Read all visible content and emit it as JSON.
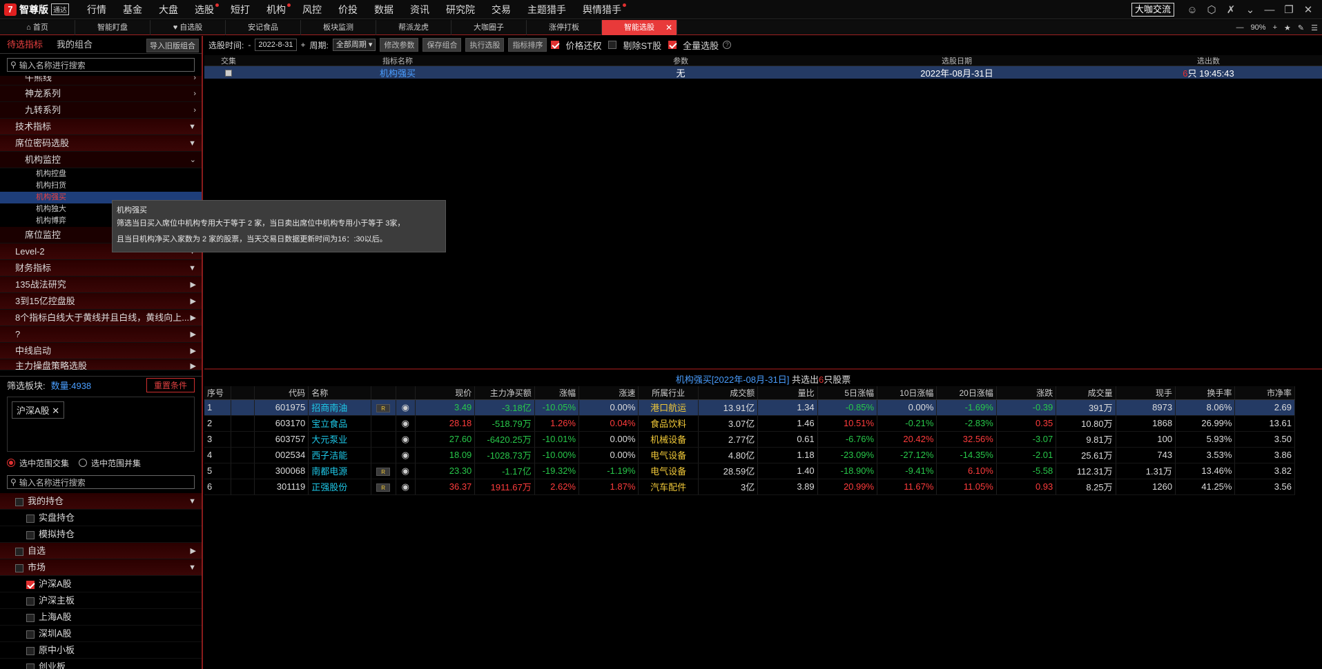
{
  "brand": {
    "name": "智尊版",
    "badge": "通达"
  },
  "top_menu": [
    {
      "label": "行情",
      "dot": false
    },
    {
      "label": "基金",
      "dot": false
    },
    {
      "label": "大盘",
      "dot": false
    },
    {
      "label": "选股",
      "dot": true
    },
    {
      "label": "短打",
      "dot": false
    },
    {
      "label": "机构",
      "dot": true
    },
    {
      "label": "风控",
      "dot": false
    },
    {
      "label": "价投",
      "dot": false
    },
    {
      "label": "数据",
      "dot": false
    },
    {
      "label": "资讯",
      "dot": false
    },
    {
      "label": "研究院",
      "dot": false
    },
    {
      "label": "交易",
      "dot": false
    },
    {
      "label": "主题猎手",
      "dot": false
    },
    {
      "label": "舆情猎手",
      "dot": true
    }
  ],
  "top_right": {
    "exchange": "大咖交流"
  },
  "tabs": [
    {
      "label": "首页",
      "icon": "home-icon",
      "active": false
    },
    {
      "label": "智能盯盘",
      "active": false
    },
    {
      "label": "自选股",
      "icon": "heart-icon",
      "active": false
    },
    {
      "label": "安记食品",
      "active": false
    },
    {
      "label": "板块监测",
      "active": false
    },
    {
      "label": "帮派龙虎",
      "active": false
    },
    {
      "label": "大咖圈子",
      "active": false
    },
    {
      "label": "涨停打板",
      "active": false
    },
    {
      "label": "智能选股",
      "active": true
    }
  ],
  "zoom": "90%",
  "left": {
    "tabs": [
      "待选指标",
      "我的组合"
    ],
    "import_btn": "导入旧版组合",
    "search_placeholder": "输入名称进行搜索",
    "tree": [
      {
        "label": "牛熊线",
        "type": "sub",
        "arrow": "›"
      },
      {
        "label": "神龙系列",
        "type": "sub",
        "arrow": "›"
      },
      {
        "label": "九转系列",
        "type": "sub",
        "arrow": "›"
      },
      {
        "label": "技术指标",
        "type": "group",
        "arrow": "▼"
      },
      {
        "label": "席位密码选股",
        "type": "group",
        "arrow": "▼"
      },
      {
        "label": "机构监控",
        "type": "sub",
        "arrow": "⌄"
      },
      {
        "label": "机构控盘",
        "type": "leaf"
      },
      {
        "label": "机构扫货",
        "type": "leaf"
      },
      {
        "label": "机构强买",
        "type": "leaf",
        "selected": true
      },
      {
        "label": "机构独大",
        "type": "leaf"
      },
      {
        "label": "机构博弈",
        "type": "leaf"
      },
      {
        "label": "席位监控",
        "type": "sub",
        "arrow": "›"
      },
      {
        "label": "Level-2",
        "type": "group",
        "arrow": "▼"
      },
      {
        "label": "财务指标",
        "type": "group",
        "arrow": "▼"
      },
      {
        "label": "135战法研究",
        "type": "group",
        "arrow": "▶"
      },
      {
        "label": "3到15亿控盘股",
        "type": "group",
        "arrow": "▶"
      },
      {
        "label": "8个指标白线大于黄线并且白线，黄线向上...",
        "type": "group",
        "arrow": "▶"
      },
      {
        "label": "?",
        "type": "group",
        "arrow": "▶"
      },
      {
        "label": "中线启动",
        "type": "group",
        "arrow": "▶"
      },
      {
        "label": "主力操盘策略选股",
        "type": "group",
        "arrow": "▶"
      }
    ],
    "filter_label": "筛选板块:",
    "filter_count": "数量:4938",
    "reset_btn": "重置条件",
    "chip": "沪深A股",
    "range": [
      "选中范围交集",
      "选中范围并集"
    ],
    "search2_placeholder": "输入名称进行搜索",
    "stock_tree": [
      {
        "label": "我的持仓",
        "level": 0,
        "arrow": "▼",
        "checked": false
      },
      {
        "label": "实盘持仓",
        "level": 1,
        "checked": false
      },
      {
        "label": "模拟持仓",
        "level": 1,
        "checked": false
      },
      {
        "label": "自选",
        "level": 0,
        "arrow": "▶",
        "checked": false
      },
      {
        "label": "市场",
        "level": 0,
        "arrow": "▼",
        "checked": false
      },
      {
        "label": "沪深A股",
        "level": 1,
        "checked": true
      },
      {
        "label": "沪深主板",
        "level": 1,
        "checked": false
      },
      {
        "label": "上海A股",
        "level": 1,
        "checked": false
      },
      {
        "label": "深圳A股",
        "level": 1,
        "checked": false
      },
      {
        "label": "原中小板",
        "level": 1,
        "checked": false
      },
      {
        "label": "创业板",
        "level": 1,
        "checked": false
      }
    ]
  },
  "toolbar": {
    "time_label": "选股时间:",
    "minus": "-",
    "date": "2022-8-31",
    "plus": "+",
    "period_label": "周期:",
    "period": "全部周期",
    "buttons": [
      "修改参数",
      "保存组合",
      "执行选股",
      "指标排序"
    ],
    "checks": [
      {
        "label": "价格还权",
        "on": true
      },
      {
        "label": "剔除ST股",
        "on": false
      },
      {
        "label": "全量选股",
        "on": true
      }
    ],
    "help": "?"
  },
  "upper": {
    "headers": [
      "交集",
      "指标名称",
      "参数",
      "选股日期",
      "选出数"
    ],
    "row": {
      "name": "机构强买",
      "param": "无",
      "date": "2022年-08月-31日",
      "count": "6",
      "count_suffix": "只 19:45:43"
    }
  },
  "tooltip": {
    "title": "机构强买",
    "line1": "筛选当日买入席位中机构专用大于等于 2 家，当日卖出席位中机构专用小于等于 3家，",
    "line2": "且当日机构净买入家数为 2 家的股票，当天交易日数据更新时间为16：:30以后。"
  },
  "lower_title": {
    "pre": "机构强买[2022年-08月-31日]",
    "mid": " 共选出",
    "count": "6",
    "post": "只股票"
  },
  "columns": [
    "序号",
    "",
    "代码",
    "名称",
    "",
    "",
    "现价",
    "主力净买额",
    "涨幅",
    "涨速",
    "所属行业",
    "成交额",
    "量比",
    "5日涨幅",
    "10日涨幅",
    "20日涨幅",
    "涨跌",
    "成交量",
    "现手",
    "换手率",
    "市净率"
  ],
  "rows": [
    {
      "no": "1",
      "code": "601975",
      "name": "招商南油",
      "r": true,
      "price": "3.49",
      "net": "-3.18亿",
      "chg": "-10.05%",
      "speed": "0.00%",
      "ind": "港口航运",
      "amt": "13.91亿",
      "vr": "1.34",
      "d5": "-0.85%",
      "d10": "0.00%",
      "d20": "-1.69%",
      "diff": "-0.39",
      "vol": "391万",
      "hand": "8973",
      "turn": "8.06%",
      "pb": "2.69",
      "cls": {
        "price": "dn",
        "net": "dn",
        "chg": "dn",
        "speed": "nm",
        "d5": "dn",
        "d10": "nm",
        "d20": "dn",
        "diff": "dn"
      }
    },
    {
      "no": "2",
      "code": "603170",
      "name": "宝立食品",
      "r": false,
      "price": "28.18",
      "net": "-518.79万",
      "chg": "1.26%",
      "speed": "0.04%",
      "ind": "食品饮料",
      "amt": "3.07亿",
      "vr": "1.46",
      "d5": "10.51%",
      "d10": "-0.21%",
      "d20": "-2.83%",
      "diff": "0.35",
      "vol": "10.80万",
      "hand": "1868",
      "turn": "26.99%",
      "pb": "13.61",
      "cls": {
        "price": "up",
        "net": "dn",
        "chg": "up",
        "speed": "up",
        "d5": "up",
        "d10": "dn",
        "d20": "dn",
        "diff": "up"
      }
    },
    {
      "no": "3",
      "code": "603757",
      "name": "大元泵业",
      "r": false,
      "price": "27.60",
      "net": "-6420.25万",
      "chg": "-10.01%",
      "speed": "0.00%",
      "ind": "机械设备",
      "amt": "2.77亿",
      "vr": "0.61",
      "d5": "-6.76%",
      "d10": "20.42%",
      "d20": "32.56%",
      "diff": "-3.07",
      "vol": "9.81万",
      "hand": "100",
      "turn": "5.93%",
      "pb": "3.50",
      "cls": {
        "price": "dn",
        "net": "dn",
        "chg": "dn",
        "speed": "nm",
        "d5": "dn",
        "d10": "up",
        "d20": "up",
        "diff": "dn"
      }
    },
    {
      "no": "4",
      "code": "002534",
      "name": "西子洁能",
      "r": false,
      "price": "18.09",
      "net": "-1028.73万",
      "chg": "-10.00%",
      "speed": "0.00%",
      "ind": "电气设备",
      "amt": "4.80亿",
      "vr": "1.18",
      "d5": "-23.09%",
      "d10": "-27.12%",
      "d20": "-14.35%",
      "diff": "-2.01",
      "vol": "25.61万",
      "hand": "743",
      "turn": "3.53%",
      "pb": "3.86",
      "cls": {
        "price": "dn",
        "net": "dn",
        "chg": "dn",
        "speed": "nm",
        "d5": "dn",
        "d10": "dn",
        "d20": "dn",
        "diff": "dn"
      }
    },
    {
      "no": "5",
      "code": "300068",
      "name": "南都电源",
      "r": true,
      "price": "23.30",
      "net": "-1.17亿",
      "chg": "-19.32%",
      "speed": "-1.19%",
      "ind": "电气设备",
      "amt": "28.59亿",
      "vr": "1.40",
      "d5": "-18.90%",
      "d10": "-9.41%",
      "d20": "6.10%",
      "diff": "-5.58",
      "vol": "112.31万",
      "hand": "1.31万",
      "turn": "13.46%",
      "pb": "3.82",
      "cls": {
        "price": "dn",
        "net": "dn",
        "chg": "dn",
        "speed": "dn",
        "d5": "dn",
        "d10": "dn",
        "d20": "up",
        "diff": "dn"
      }
    },
    {
      "no": "6",
      "code": "301119",
      "name": "正强股份",
      "r": true,
      "price": "36.37",
      "net": "1911.67万",
      "chg": "2.62%",
      "speed": "1.87%",
      "ind": "汽车配件",
      "amt": "3亿",
      "vr": "3.89",
      "d5": "20.99%",
      "d10": "11.67%",
      "d20": "11.05%",
      "diff": "0.93",
      "vol": "8.25万",
      "hand": "1260",
      "turn": "41.25%",
      "pb": "3.56",
      "cls": {
        "price": "up",
        "net": "up",
        "chg": "up",
        "speed": "up",
        "d5": "up",
        "d10": "up",
        "d20": "up",
        "diff": "up"
      }
    }
  ]
}
